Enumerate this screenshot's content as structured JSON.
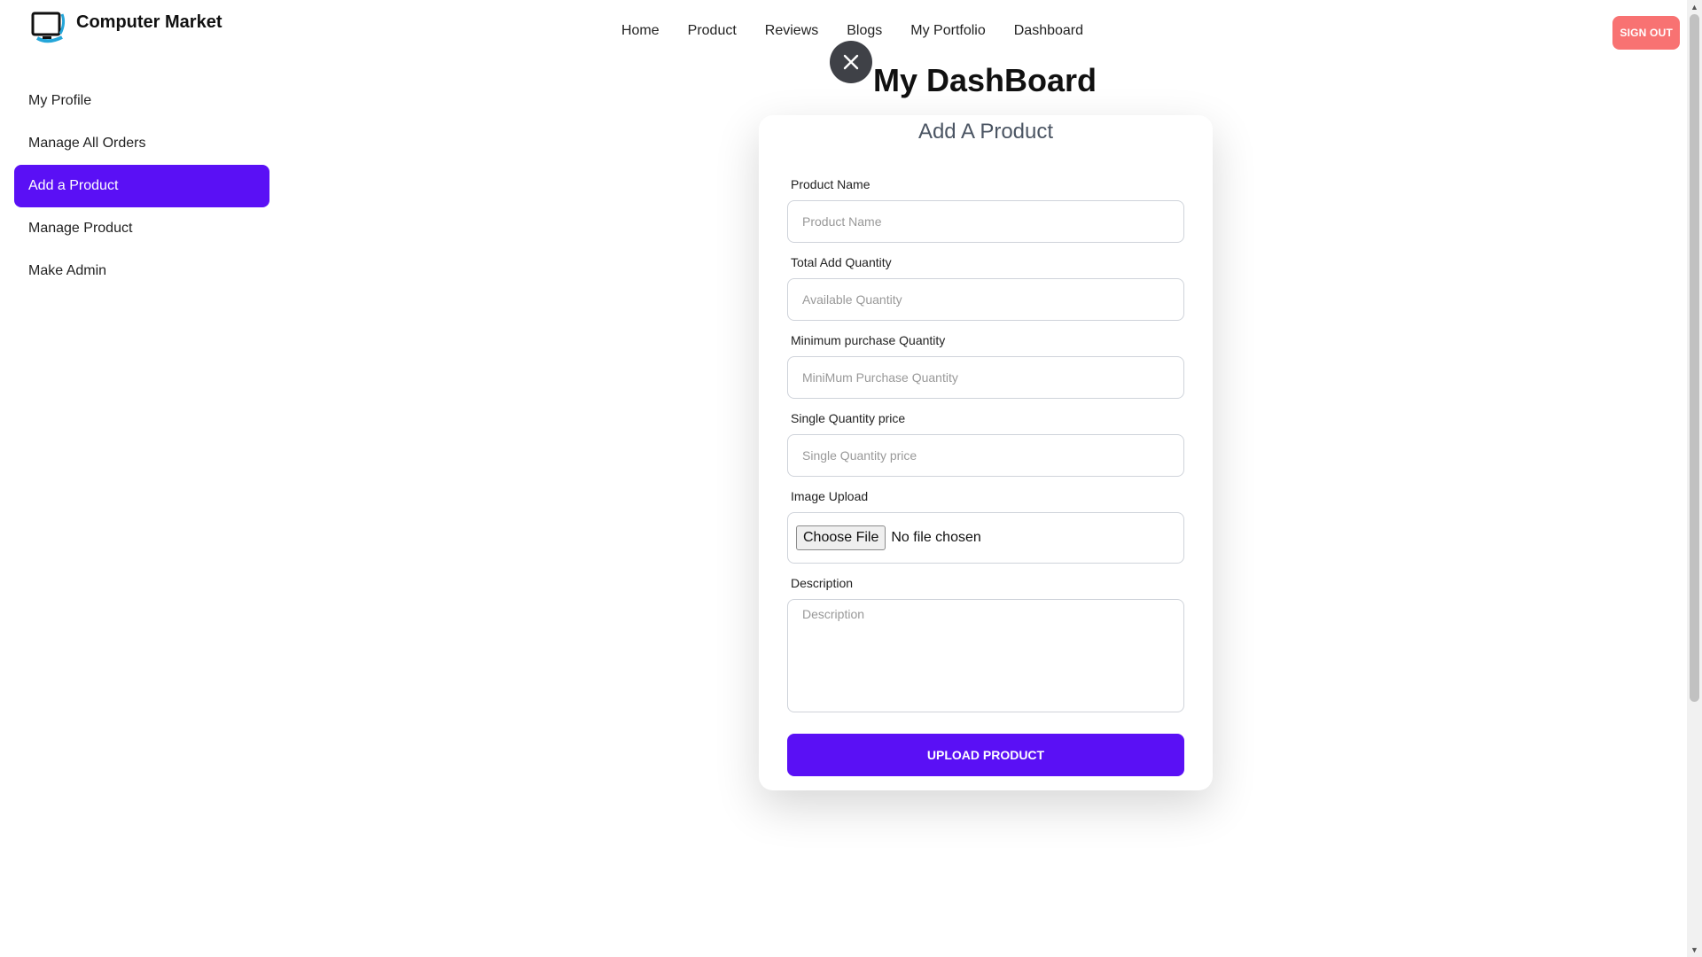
{
  "app": {
    "logo_text": "Computer Market"
  },
  "nav": {
    "items": [
      "Home",
      "Product",
      "Reviews",
      "Blogs",
      "My Portfolio",
      "Dashboard"
    ],
    "signout": "SIGN OUT"
  },
  "sidebar": {
    "items": [
      "My Profile",
      "Manage All Orders",
      "Add a Product",
      "Manage Product",
      "Make Admin"
    ],
    "active_index": 2
  },
  "page": {
    "title": "My DashBoard",
    "close_icon": "close-icon"
  },
  "form": {
    "title": "Add A Product",
    "product_name": {
      "label": "Product Name",
      "placeholder": "Product Name"
    },
    "quantity": {
      "label": "Total Add Quantity",
      "placeholder": "Available Quantity"
    },
    "minimum": {
      "label": "Minimum purchase Quantity",
      "placeholder": "MiniMum Purchase Quantity"
    },
    "price": {
      "label": "Single Quantity price",
      "placeholder": "Single Quantity price"
    },
    "image": {
      "label": "Image Upload",
      "button": "Choose File",
      "status": "No file chosen"
    },
    "description": {
      "label": "Description",
      "placeholder": "Description"
    },
    "submit": "UPLOAD PRODUCT"
  },
  "colors": {
    "accent": "#5a10f5",
    "signout": "#f87272"
  }
}
